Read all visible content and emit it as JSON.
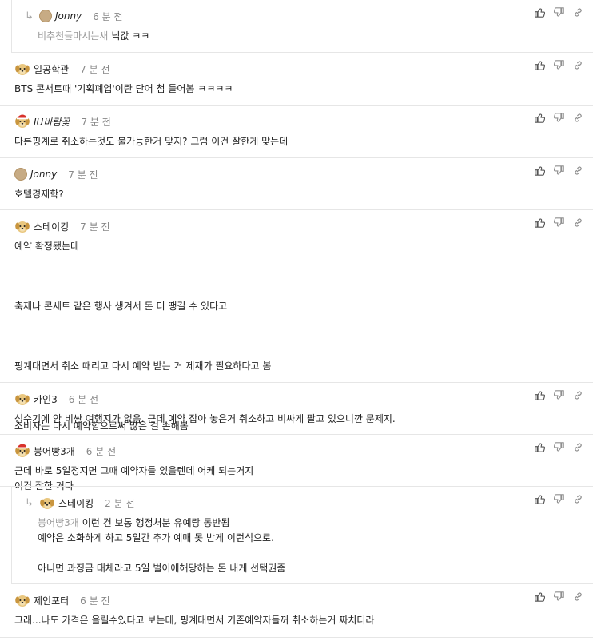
{
  "icons": {
    "like": "thumbs-up-icon",
    "dislike": "thumbs-down-icon",
    "share": "link-icon",
    "reply": "reply-arrow-icon"
  },
  "colors": {
    "divider": "#e6e6e6",
    "time": "#888888",
    "quote": "#9a9a9a"
  },
  "comments": [
    {
      "type": "reply",
      "avatar": "circle",
      "nick": "Jonny",
      "time": "6 분 전",
      "quote": "비추천들마시는새",
      "lines": [
        "닉값 ㅋㅋ"
      ]
    },
    {
      "type": "top",
      "avatar": "dog",
      "nick": "일공학관",
      "time": "7 분 전",
      "lines": [
        "BTS 콘서트때 '기획폐업'이란 단어 첨 들어봄 ㅋㅋㅋㅋ"
      ]
    },
    {
      "type": "top",
      "avatar": "dog-hat",
      "nick": "IU바람꽃",
      "time": "7 분 전",
      "lines": [
        "다른핑계로 취소하는것도 불가능한거 맞지? 그럼 이건 잘한게 맞는데"
      ]
    },
    {
      "type": "top",
      "avatar": "circle",
      "nick": "Jonny",
      "time": "7 분 전",
      "lines": [
        "호텔경제학?"
      ]
    },
    {
      "type": "top",
      "avatar": "dog",
      "nick": "스테이킹",
      "time": "7 분 전",
      "lines": [
        "예약 확정됐는데",
        "",
        "축제나 콘세트 같은 행사 생겨서 돈 더 땡길 수 있다고",
        "",
        "핑계대면서 취소 때리고 다시 예약 받는 거 제재가 필요하다고 봄",
        "",
        "소비자는 다시 예약함으로써 많은 걸 손해봄",
        "",
        "이건 잘한 거다"
      ]
    },
    {
      "type": "top",
      "avatar": "dog",
      "nick": "카인3",
      "time": "6 분 전",
      "lines": [
        "성수기에 안 비싼 여행지가 없음. 근데 예약 잡아 놓은거 취소하고 비싸게 팔고 있으니깐 문제지."
      ]
    },
    {
      "type": "top",
      "avatar": "dog-hat",
      "nick": "붕어빵3개",
      "time": "6 분 전",
      "lines": [
        "근데 바로 5일정지면 그때 예약자들 있을텐데 어케 되는거지"
      ]
    },
    {
      "type": "reply",
      "avatar": "dog",
      "nick": "스테이킹",
      "time": "2 분 전",
      "quote": "붕어빵3개",
      "lines": [
        "이런 건 보통 행정처분 유예랑 동반됨",
        "예약은 소화하게 하고 5일간 추가 예매 못 받게 이런식으로.",
        "",
        "아니면 과징금 대체라고 5일 벌이에해당하는 돈 내게 선택권줌"
      ]
    },
    {
      "type": "top",
      "avatar": "dog",
      "nick": "제인포터",
      "time": "6 분 전",
      "lines": [
        "그래...나도 가격은 올릴수있다고 보는데, 핑계대면서 기존예약자들꺼 취소하는거 짜치더라"
      ]
    }
  ]
}
